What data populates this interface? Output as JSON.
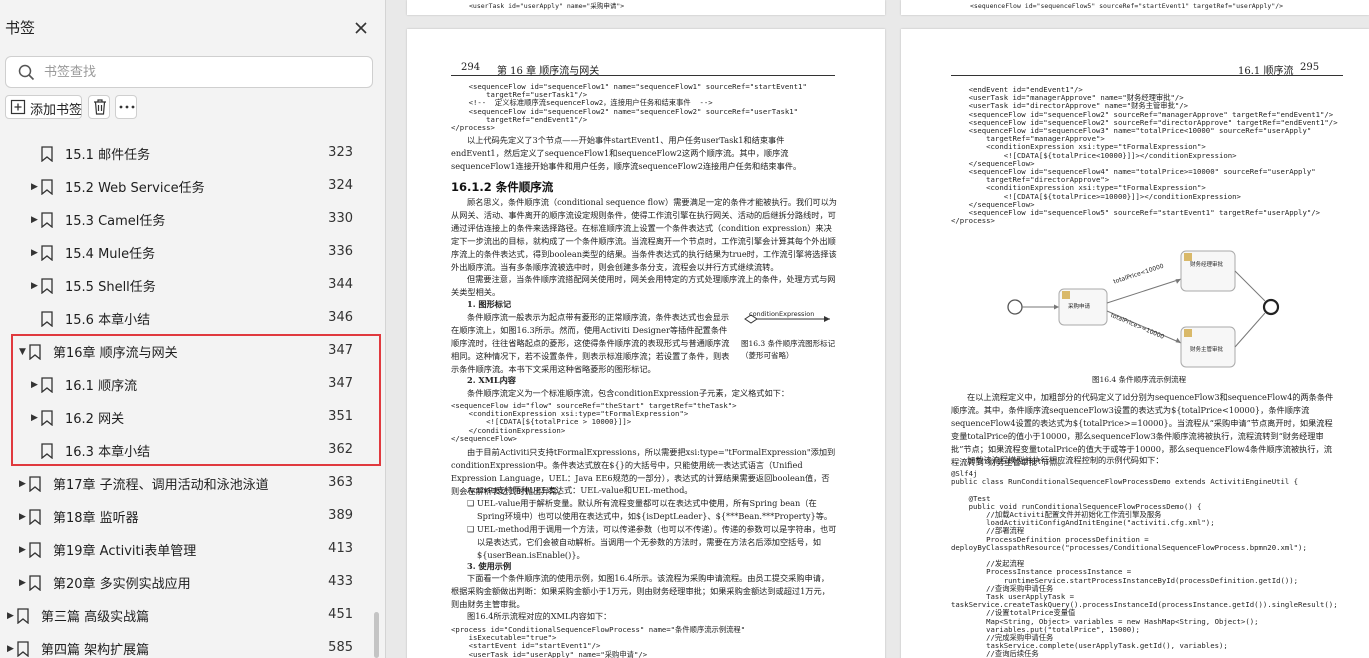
{
  "sidebar": {
    "title": "书签",
    "search_placeholder": "书签查找",
    "add_label": "添加书签",
    "items": [
      {
        "label": "15.1  邮件任务",
        "page": "323"
      },
      {
        "label": "15.2 Web Service任务",
        "page": "324"
      },
      {
        "label": "15.3 Camel任务",
        "page": "330"
      },
      {
        "label": "15.4 Mule任务",
        "page": "336"
      },
      {
        "label": "15.5  Shell任务",
        "page": "344"
      },
      {
        "label": "15.6  本章小结",
        "page": "346"
      },
      {
        "label": "第16章  顺序流与网关",
        "page": "347"
      },
      {
        "label": "16.1  顺序流",
        "page": "347"
      },
      {
        "label": "16.2  网关",
        "page": "351"
      },
      {
        "label": "16.3  本章小结",
        "page": "362"
      },
      {
        "label": "第17章  子流程、调用活动和泳池泳道",
        "page": "363"
      },
      {
        "label": "第18章  监听器",
        "page": "389"
      },
      {
        "label": "第19章  Activiti表单管理",
        "page": "413"
      },
      {
        "label": "第20章  多实例实战应用",
        "page": "433"
      },
      {
        "label": "第三篇  高级实战篇",
        "page": "451"
      },
      {
        "label": "第四篇  架构扩展篇",
        "page": "585"
      }
    ]
  },
  "left_page": {
    "top_line": "<userTask id=\"userApply\" name=\"采购申请\">",
    "page_number": "294",
    "chapter": "第 16 章  顺序流与网关",
    "code1": "    <sequenceFlow id=\"sequenceFlow1\" name=\"sequenceFlow1\" sourceRef=\"startEvent1\"\n        targetRef=\"userTask1\"/>\n    <!--  定义标准顺序流sequenceFlow2，连接用户任务和结束事件  -->\n    <sequenceFlow id=\"sequenceFlow2\" name=\"sequenceFlow2\" sourceRef=\"userTask1\"\n        targetRef=\"endEvent1\"/>\n</process>",
    "p1": "以上代码先定义了3个节点——开始事件startEvent1、用户任务userTask1和结束事件endEvent1，然后定义了sequenceFlow1和sequenceFlow2这两个顺序流。其中，顺序流sequenceFlow1连接开始事件和用户任务，顺序流sequenceFlow2连接用户任务和结束事件。",
    "section": "16.1.2  条件顺序流",
    "p2": "顾名思义，条件顺序流（conditional sequence flow）需要满足一定的条件才能被执行。我们可以为从网关、活动、事件离开的顺序流设定规则条件，使得工作流引擎在执行网关、活动的后继拆分路线时，可通过评估连接上的条件来选择路径。在标准顺序流上设置一个条件表达式（condition expression）来决定下一步流出的目标，就构成了一个条件顺序流。当流程离开一个节点时，工作流引擎会计算其每个外出顺序流上的条件表达式，得到boolean类型的结果。当条件表达式的执行结果为true时，工作流引擎将选择该外出顺序流。当有多条顺序流被选中时，则会创建多条分支，流程会以并行方式继续流转。",
    "p3": "但需要注意，当条件顺序流搭配网关使用时，网关会用特定的方式处理顺序流上的条件，处理方式与网关类型相关。",
    "h1": "1. 图形标记",
    "p4": "条件顺序流一般表示为起点带有菱形的正常顺序流，条件表达式也会显示在顺序流上，如图16.3所示。然而，使用Activiti Designer等插件配置条件顺序流时，往往省略起点的菱形，这使得条件顺序流的表现形式与普通顺序流相同。这种情况下，若不设置条件，则表示标准顺序流；若设置了条件，则表示条件顺序流。本书下文采用这种省略菱形的图形标记。",
    "fig3_label": "conditionExpression",
    "fig3_caption": "图16.3  条件顺序流图形标记（菱形可省略）",
    "h2": "2. XML内容",
    "p5": "条件顺序流定义为一个标准顺序流，包含conditionExpression子元素，定义格式如下：",
    "code2": "<sequenceFlow id=\"flow\" sourceRef=\"theStart\" targetRef=\"theTask\">\n    <conditionExpression xsi:type=\"tFormalExpression\">\n        <![CDATA[${totalPrice > 10000}]]>\n    </conditionExpression>\n</sequenceFlow>",
    "p6": "由于目前Activiti只支持tFormalExpressions，所以需要把xsi:type=\"tFormalExpression\"添加到conditionExpression中。条件表达式放在${}的大括号中，只能使用统一表达式语言（Unified Expression Language，UEL：Java EE6规范的一部分），表达式的计算结果需要返回boolean值，否则会在解析表达式时抛出异常。",
    "p7": "Activiti支持两种UEL表达式：UEL-value和UEL-method。",
    "b1": "❑ UEL-value用于解析变量。默认所有流程变量都可以在表达式中使用，所有Spring bean（在Spring环境中）也可以使用在表达式中，如${isDeptLeader}、${***Bean.***Property}等。",
    "b2": "❑ UEL-method用于调用一个方法，可以传递参数（也可以不传递）。传递的参数可以是字符串，也可以是表达式，它们会被自动解析。当调用一个无参数的方法时，需要在方法名后添加空括号，如${userBean.isEnable()}。",
    "h3": "3. 使用示例",
    "p8": "下面看一个条件顺序流的使用示例，如图16.4所示。该流程为采购申请流程。由员工提交采购申请，根据采购金额做出判断：如果采购金额小于1万元，则由财务经理审批；如果采购金额达到或超过1万元，则由财务主管审批。",
    "p9": "图16.4所示流程对应的XML内容如下：",
    "code3": "<process id=\"ConditionalSequenceFlowProcess\" name=\"条件顺序流示例流程\"\n    isExecutable=\"true\">\n    <startEvent id=\"startEvent1\"/>\n    <userTask id=\"userApply\" name=\"采购申请\"/>"
  },
  "right_page": {
    "top_line": "<sequenceFlow id=\"sequenceFlow5\" sourceRef=\"startEvent1\" targetRef=\"userApply\"/>",
    "section": "16.1  顺序流",
    "page_number": "295",
    "code1": "    <endEvent id=\"endEvent1\"/>\n    <userTask id=\"managerApprove\" name=\"财务经理审批\"/>\n    <userTask id=\"directorApprove\" name=\"财务主管审批\"/>\n    <sequenceFlow id=\"sequenceFlow2\" sourceRef=\"managerApprove\" targetRef=\"endEvent1\"/>\n    <sequenceFlow id=\"sequenceFlow2\" sourceRef=\"directorApprove\" targetRef=\"endEvent1\"/>\n    <sequenceFlow id=\"sequenceFlow3\" name=\"totalPrice<10000\" sourceRef=\"userApply\"\n        targetRef=\"managerApprove\">\n        <conditionExpression xsi:type=\"tFormalExpression\">\n            <![CDATA[${totalPrice<10000}]]></conditionExpression>\n    </sequenceFlow>\n    <sequenceFlow id=\"sequenceFlow4\" name=\"totalPrice>=10000\" sourceRef=\"userApply\"\n        targetRef=\"directorApprove\">\n        <conditionExpression xsi:type=\"tFormalExpression\">\n            <![CDATA[${totalPrice>=10000}]]></conditionExpression>\n    </sequenceFlow>\n    <sequenceFlow id=\"sequenceFlow5\" sourceRef=\"startEvent1\" targetRef=\"userApply\"/>\n</process>",
    "diagram": {
      "task_apply": "采购申请",
      "task_manager": "财务经理审批",
      "task_director": "财务主管审批",
      "flow_low": "totalPrice<10000",
      "flow_high": "totalPrice>=10000"
    },
    "fig4_caption": "图16.4  条件顺序流示例流程",
    "p1": "在以上流程定义中，加粗部分的代码定义了id分别为sequenceFlow3和sequenceFlow4的两条条件顺序流。其中，条件顺序流sequenceFlow3设置的表达式为${totalPrice<10000}，条件顺序流sequenceFlow4设置的表达式为${totalPrice>=10000}。当流程从“采购申请”节点离开时，如果流程变量totalPrice的值小于10000，那么sequenceFlow3条件顺序流将被执行，流程流转到“财务经理审批”节点；如果流程变量totalPrice的值大于或等于10000，那么sequenceFlow4条件顺序流被执行，流程流转到“财务主管审批”节点。",
    "p2": "加载该流程模型并执行相应流程控制的示例代码如下：",
    "code2": "@Slf4j\npublic class RunConditionalSequenceFlowProcessDemo extends ActivitiEngineUtil {\n\n    @Test\n    public void runConditionalSequenceFlowProcessDemo() {\n        //加载Activiti配置文件并初始化工作流引擎及服务\n        loadActivitiConfigAndInitEngine(\"activiti.cfg.xml\");\n        //部署流程\n        ProcessDefinition processDefinition =\ndeployByClasspathResource(\"processes/ConditionalSequenceFlowProcess.bpmn20.xml\");\n\n        //发起流程\n        ProcessInstance processInstance =\n            runtimeService.startProcessInstanceById(processDefinition.getId());\n        //查询采购申请任务\n        Task userApplyTask =\ntaskService.createTaskQuery().processInstanceId(processInstance.getId()).singleResult();\n        //设置totalPrice变量值\n        Map<String, Object> variables = new HashMap<String, Object>();\n        variables.put(\"totalPrice\", 15000);\n        //完成采购申请任务\n        taskService.complete(userApplyTask.getId(), variables);\n        //查询后续任务"
  }
}
